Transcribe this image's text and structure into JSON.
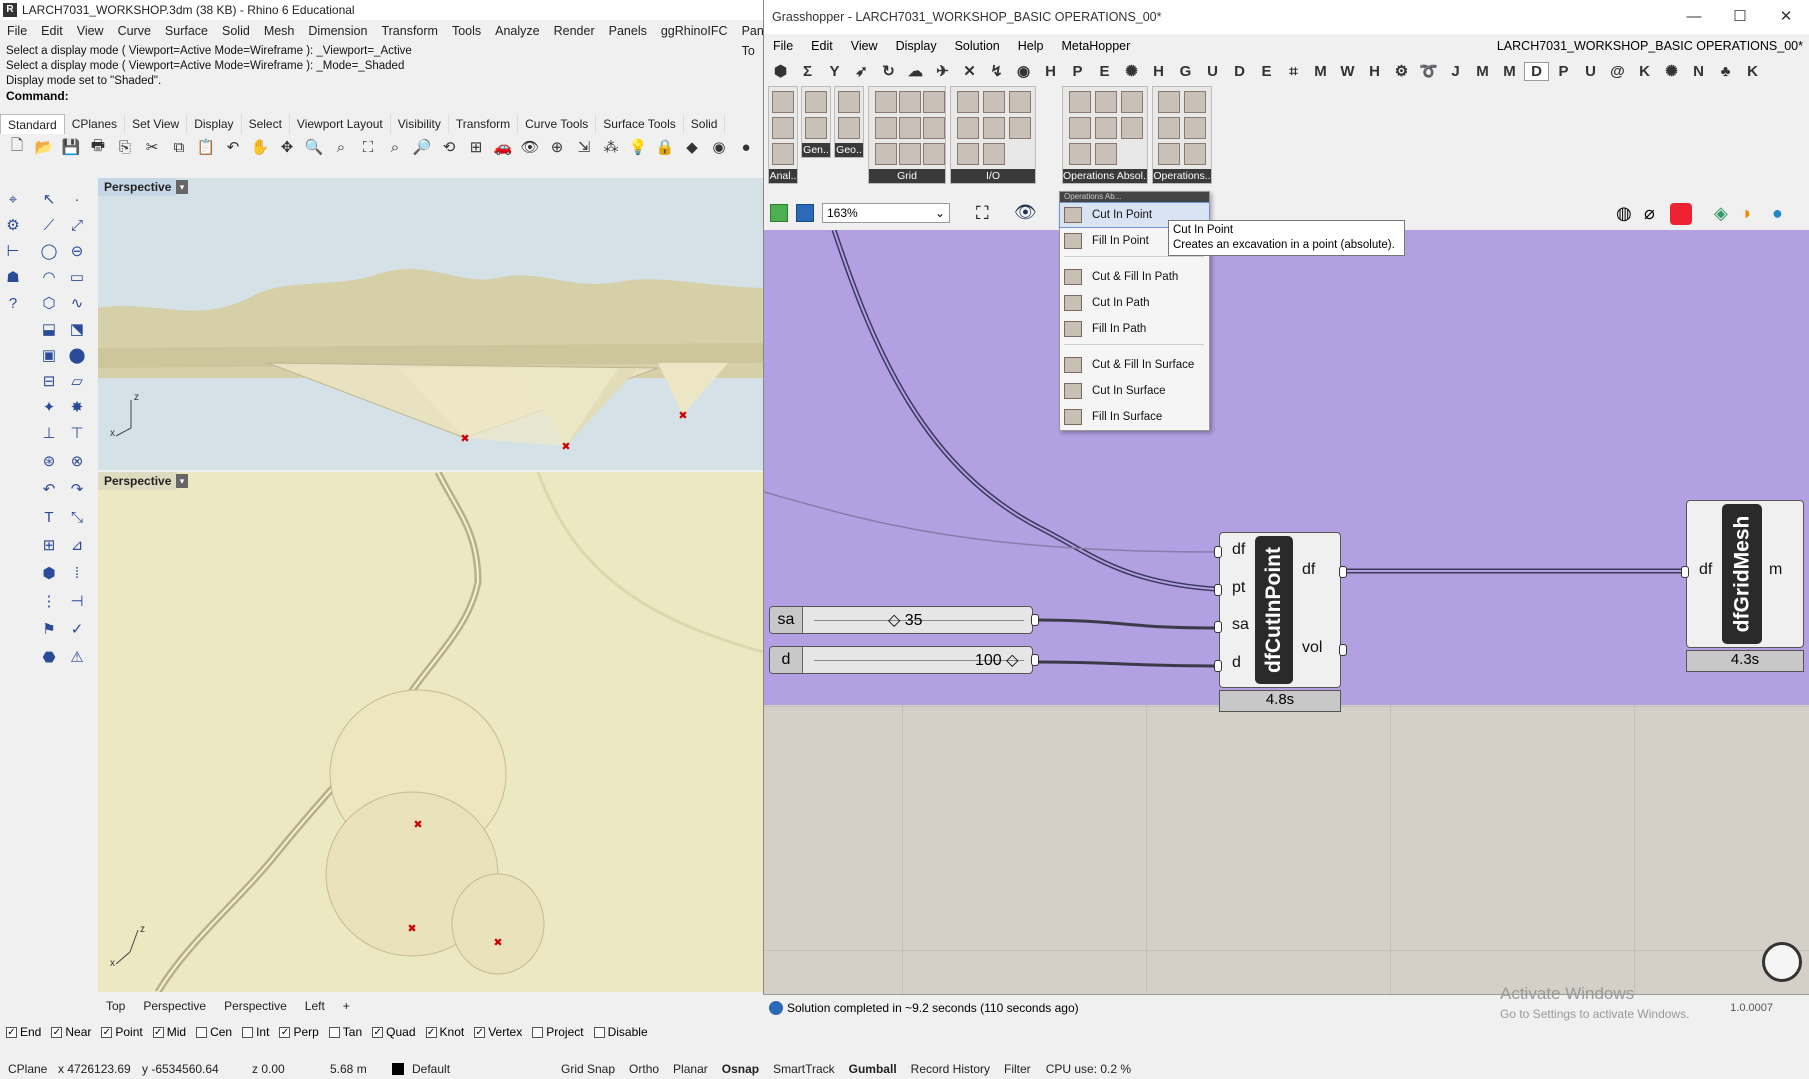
{
  "rhino": {
    "title": "LARCH7031_WORKSHOP.3dm (38 KB) - Rhino 6 Educational",
    "menu": [
      "File",
      "Edit",
      "View",
      "Curve",
      "Surface",
      "Solid",
      "Mesh",
      "Dimension",
      "Transform",
      "Tools",
      "Analyze",
      "Render",
      "Panels",
      "ggRhinoIFC",
      "Paneling To"
    ],
    "command_history": [
      "Select a display mode ( Viewport=Active  Mode=Wireframe ): _Viewport=_Active",
      "Select a display mode ( Viewport=Active  Mode=Wireframe ): _Mode=_Shaded",
      "Display mode set to \"Shaded\"."
    ],
    "command_label": "Command:",
    "toolbar_tabs": [
      "Standard",
      "CPlanes",
      "Set View",
      "Display",
      "Select",
      "Viewport Layout",
      "Visibility",
      "Transform",
      "Curve Tools",
      "Surface Tools",
      "Solid"
    ],
    "viewport_top_label": "Perspective",
    "viewport_bottom_label": "Perspective",
    "viewport_tabs": [
      "Top",
      "Perspective",
      "Perspective",
      "Left",
      "+"
    ],
    "osnaps": [
      {
        "label": "End",
        "checked": true
      },
      {
        "label": "Near",
        "checked": true
      },
      {
        "label": "Point",
        "checked": true
      },
      {
        "label": "Mid",
        "checked": true
      },
      {
        "label": "Cen",
        "checked": false
      },
      {
        "label": "Int",
        "checked": false
      },
      {
        "label": "Perp",
        "checked": true
      },
      {
        "label": "Tan",
        "checked": false
      },
      {
        "label": "Quad",
        "checked": true
      },
      {
        "label": "Knot",
        "checked": true
      },
      {
        "label": "Vertex",
        "checked": true
      },
      {
        "label": "Project",
        "checked": false
      },
      {
        "label": "Disable",
        "checked": false
      }
    ],
    "status": {
      "cplane": "CPlane",
      "x": "x 4726123.69",
      "y": "y -6534560.64",
      "z": "z 0.00",
      "units": "5.68 m",
      "layer": "Default",
      "toggles": [
        "Grid Snap",
        "Ortho",
        "Planar",
        "Osnap",
        "SmartTrack",
        "Gumball",
        "Record History",
        "Filter"
      ],
      "cpu": "CPU use: 0.2 %"
    }
  },
  "gh": {
    "title": "Grasshopper - LARCH7031_WORKSHOP_BASIC OPERATIONS_00*",
    "file_name": "LARCH7031_WORKSHOP_BASIC OPERATIONS_00*",
    "menu": [
      "File",
      "Edit",
      "View",
      "Display",
      "Solution",
      "Help",
      "MetaHopper"
    ],
    "tab_glyphs": [
      "⬢",
      "Σ",
      "Y",
      "➶",
      "↻",
      "☁",
      "✈",
      "✕",
      "↯",
      "◉",
      "H",
      "P",
      "E",
      "✺",
      "H",
      "G",
      "U",
      "D",
      "E",
      "⌗",
      "M",
      "W",
      "H",
      "⚙",
      "➰",
      "J",
      "M",
      "M",
      "D",
      "P",
      "U",
      "@",
      "K",
      "✺",
      "N",
      "♣",
      "K"
    ],
    "panels": [
      "Anal..",
      "Gen..",
      "Geo..",
      "Grid",
      "I/O",
      "Operations Absol..",
      "Operations.."
    ],
    "zoom": "163%",
    "dropdown_header": "Operations Ab...",
    "dropdown_items": [
      {
        "label": "Cut In Point",
        "highlight": true
      },
      {
        "label": "Fill In Point",
        "highlight": false
      },
      {
        "label": "Cut & Fill In Path",
        "highlight": false
      },
      {
        "label": "Cut In Path",
        "highlight": false
      },
      {
        "label": "Fill In Path",
        "highlight": false
      },
      {
        "label": "Cut & Fill In Surface",
        "highlight": false
      },
      {
        "label": "Cut In Surface",
        "highlight": false
      },
      {
        "label": "Fill In Surface",
        "highlight": false
      }
    ],
    "tooltip": {
      "title": "Cut In Point",
      "text": "Creates an excavation in a point (absolute)."
    },
    "slider_sa": {
      "label": "sa",
      "value": "35"
    },
    "slider_d": {
      "label": "d",
      "value": "100"
    },
    "comp_cut": {
      "name": "dfCutInPoint",
      "inputs": [
        "df",
        "pt",
        "sa",
        "d"
      ],
      "outputs": [
        "df",
        "vol"
      ],
      "time": "4.8s"
    },
    "comp_grid": {
      "name": "dfGridMesh",
      "inputs": [
        "df"
      ],
      "outputs": [
        "m"
      ],
      "time": "4.3s"
    },
    "status": "Solution completed in ~9.2 seconds (110 seconds ago)",
    "version": "1.0.0007",
    "activate": "Activate Windows",
    "activate_sub": "Go to Settings to activate Windows."
  }
}
